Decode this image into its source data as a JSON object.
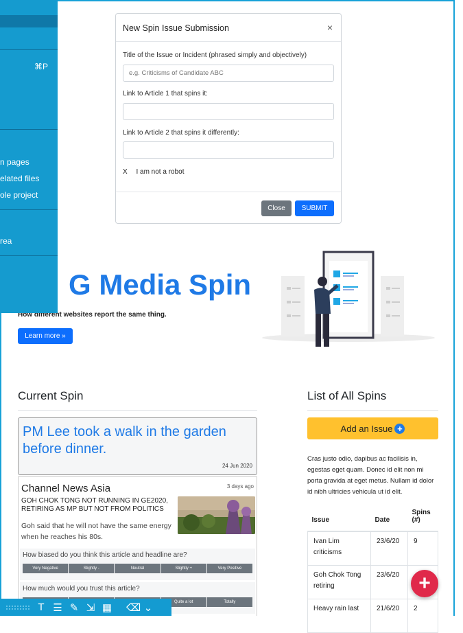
{
  "side_menu": {
    "shortcut": "⌘P",
    "items": [
      "n pages",
      "elated files",
      "ole project"
    ],
    "lower_item": "rea"
  },
  "modal": {
    "title": "New Spin Issue Submission",
    "close": "×",
    "field1_label": "Title of the Issue or Incident (phrased simply and objectively)",
    "field1_placeholder": "e.g. Criticisms of Candidate ABC",
    "field2_label": "Link to Article 1 that spins it:",
    "field3_label": "Link to Article 2 that spins it differently:",
    "robot_mark": "X",
    "robot_text": "I am not a robot",
    "close_button": "Close",
    "submit_button": "SUBMIT"
  },
  "hero": {
    "title": "G Media Spin",
    "subtitle": "How different websites report the same thing.",
    "learn_more": "Learn more »"
  },
  "current_spin": {
    "heading": "Current Spin",
    "headline": "PM Lee took a walk in the garden before dinner.",
    "date": "24 Jun 2020",
    "article": {
      "source": "Channel News Asia",
      "ago": "3 days ago",
      "title": "GOH CHOK TONG NOT RUNNING IN GE2020, RETIRING AS MP BUT NOT FROM POLITICS",
      "body": "Goh said that he will not have the same energy when he reaches his 80s.",
      "q1": "How biased do you think this article and headline are?",
      "bias_scale": [
        "Very Negative",
        "Slightly -",
        "Neutral",
        "Slightly +",
        "Very Positive"
      ],
      "q2": "How much would you trust this article?",
      "trust_scale": [
        "",
        "",
        "",
        "Quite a lot",
        "Totally"
      ]
    }
  },
  "all_spins": {
    "heading": "List of All Spins",
    "add_button": "Add an Issue",
    "add_icon": "+",
    "description": "Cras justo odio, dapibus ac facilisis in, egestas eget quam. Donec id elit non mi porta gravida at eget metus. Nullam id dolor id nibh ultricies vehicula ut id elit.",
    "columns": [
      "Issue",
      "Date",
      "Spins (#)"
    ],
    "rows": [
      [
        "Ivan Lim criticisms",
        "23/6/20",
        "9"
      ],
      [
        "Goh Chok Tong retiring",
        "23/6/20",
        ""
      ],
      [
        "Heavy rain last",
        "21/6/20",
        "2"
      ]
    ]
  },
  "fab": {
    "icon": "+"
  },
  "toolbar": {
    "icons": [
      "text-icon",
      "sliders-icon",
      "brush-icon",
      "export-icon",
      "table-icon",
      "trash-icon",
      "chevron-down-icon"
    ],
    "glyphs": [
      "T⃓",
      "☰",
      "✎",
      "⇲",
      "▦",
      "🗑",
      "⌄"
    ]
  },
  "colors": {
    "accent": "#1f7ae6",
    "side_panel": "#159bcf",
    "add_button": "#ffc12e",
    "fab": "#e0294a"
  }
}
